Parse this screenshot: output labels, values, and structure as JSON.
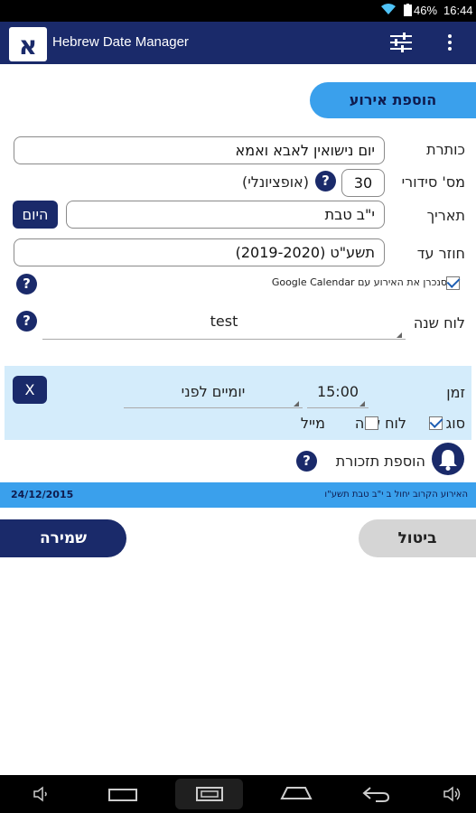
{
  "status_bar": {
    "battery": "46%",
    "time": "16:44"
  },
  "app_bar": {
    "logo_letter": "א",
    "title": "Hebrew Date Manager"
  },
  "form": {
    "section_title": "הוספת אירוע",
    "title_label": "כותרת",
    "title_value": "יום נישואין לאבא ואמא",
    "serial_label": "מס' סידורי",
    "serial_value": "30",
    "serial_optional": "(אופציונלי)",
    "date_label": "תאריך",
    "date_value": "י\"ב טבת",
    "today_button": "היום",
    "repeat_label": "חוזר עד",
    "repeat_value": "תשע\"ט (2019-2020)",
    "sync_label": "סנכרן את האירוע עם Google Calendar",
    "sync_checked": true,
    "calendar_label": "לוח שנה",
    "calendar_value": "test",
    "help_glyph": "?"
  },
  "reminder": {
    "remove_button": "X",
    "time_label": "זמן",
    "time_value": "15:00",
    "offset_value": "יומיים לפני",
    "type_label": "סוג",
    "type_calendar": "לוח שנה",
    "type_calendar_checked": true,
    "type_email": "מייל",
    "type_email_checked": false,
    "add_reminder": "הוספת תזכורת"
  },
  "info_strip": {
    "next_event": "האירוע הקרוב יחול ב י\"ב טבת תשע\"ו",
    "date": "24/12/2015"
  },
  "actions": {
    "save": "שמירה",
    "cancel": "ביטול"
  },
  "nav": {
    "icons": [
      "volume-down-icon",
      "recents-icon",
      "screenshot-icon",
      "home-icon",
      "back-icon",
      "volume-up-icon"
    ]
  },
  "colors": {
    "navy": "#1a2a6a",
    "accent_blue": "#3aa0ec",
    "panel_blue": "#d4ecfb"
  }
}
